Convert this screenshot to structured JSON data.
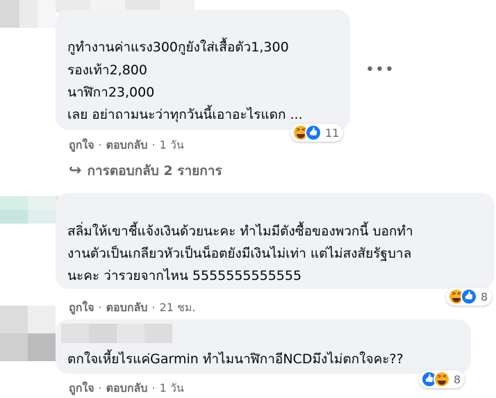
{
  "comments": [
    {
      "lines": [
        "กูทำงานค่าแรง300กูยังใส่เสื้อตัว1,300",
        "รองเท้า2,800",
        "นาฬิกา23,000",
        "เลย อย่าถามนะว่าทุกวันนี้เอาอะไรแดก ..."
      ],
      "actions": {
        "like": "ถูกใจ",
        "reply": "ตอบกลับ",
        "time": "1 วัน"
      },
      "reactions": {
        "icons": [
          "haha-icon",
          "like-icon"
        ],
        "count": "11"
      },
      "more_label": "•••",
      "replies_label": "การตอบกลับ 2 รายการ"
    },
    {
      "lines": [
        "สลิ่มให้เขาชี้แจ้งเงินด้วยนะคะ ทำไมมีตังซื้อของพวกนี้ บอกทำ",
        "งานตัวเป็นเกลียวหัวเป็นน็อตยังมีเงินไม่เท่า แต่ไม่สงสัยรัฐบาล",
        "นะคะ ว่ารวยจากไหน 5555555555555"
      ],
      "actions": {
        "like": "ถูกใจ",
        "reply": "ตอบกลับ",
        "time": "21 ชม."
      },
      "reactions": {
        "icons": [
          "haha-icon",
          "like-icon"
        ],
        "count": "8"
      }
    },
    {
      "lines": [
        "ตกใจเหี้ยไรแค่Garmin ทำไมนาฬิกาอีNCDมึงไม่ตกใจคะ??"
      ],
      "actions": {
        "like": "ถูกใจ",
        "reply": "ตอบกลับ",
        "time": "1 วัน"
      },
      "reactions": {
        "icons": [
          "like-icon",
          "haha-icon"
        ],
        "count": "8"
      }
    }
  ],
  "colors": {
    "bubble": "#f0f2f5",
    "secondary_text": "#65676b",
    "primary_text": "#050505",
    "like_blue": "#1877f2",
    "haha_yellow": "#f7b125"
  }
}
